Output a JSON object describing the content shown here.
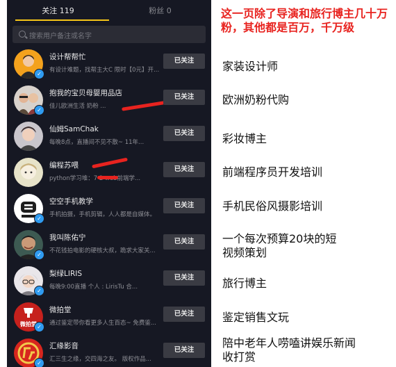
{
  "tabs": {
    "following": "关注 119",
    "fans": "粉丝 0"
  },
  "search": {
    "placeholder": "搜索用户备注或名字"
  },
  "follow_button_label": "已关注",
  "users": [
    {
      "name": "设计帮帮忙",
      "desc": "有设计难题，找帮主大C 限时【0元】开...",
      "verified": true
    },
    {
      "name": "抱我的宝贝母婴用品店",
      "desc": "佳儿欧洲生活 奶粉 ...",
      "verified": true
    },
    {
      "name": "仙姆SamChak",
      "desc": "每晚8点，直播间不见不散~ 11年...",
      "verified": false
    },
    {
      "name": "编程苏喂",
      "desc": "python学习堆：7 2 web前端学...",
      "verified": false
    },
    {
      "name": "空空手机教学",
      "desc": "手机拍摄，手机剪辑，人人都是自媒体。",
      "verified": true
    },
    {
      "name": "我叫陈佑宁",
      "desc": "不花钱拍电影的硬核大叔，跪求大家关...",
      "verified": true
    },
    {
      "name": "梨绿LIRIS",
      "desc": "每晚9:00直播   个人 : LirisTu 合...",
      "verified": true
    },
    {
      "name": "微拍堂",
      "desc": "通过鉴定带你看更多人生百态~ 免费鉴...",
      "verified": true
    },
    {
      "name": "汇缘影音",
      "desc": "汇三生之缘，交四海之友。 版权作品...",
      "verified": true
    }
  ],
  "headline": "这一页除了导演和旅行博主几十万粉，其他都是百万，千万级",
  "annotations": [
    "家装设计师",
    "欧洲奶粉代购",
    "彩妆博主",
    "前端程序员开发培训",
    "手机民俗风摄影培训",
    "一个每次预算20块的短\n视频策划",
    "旅行博主",
    "鉴定销售文玩",
    "陪中老年人唠嗑讲娱乐新闻\n收打赏"
  ],
  "avatar_texts": {
    "logo_2_small": "KK",
    "logo_8": "微拍堂"
  }
}
